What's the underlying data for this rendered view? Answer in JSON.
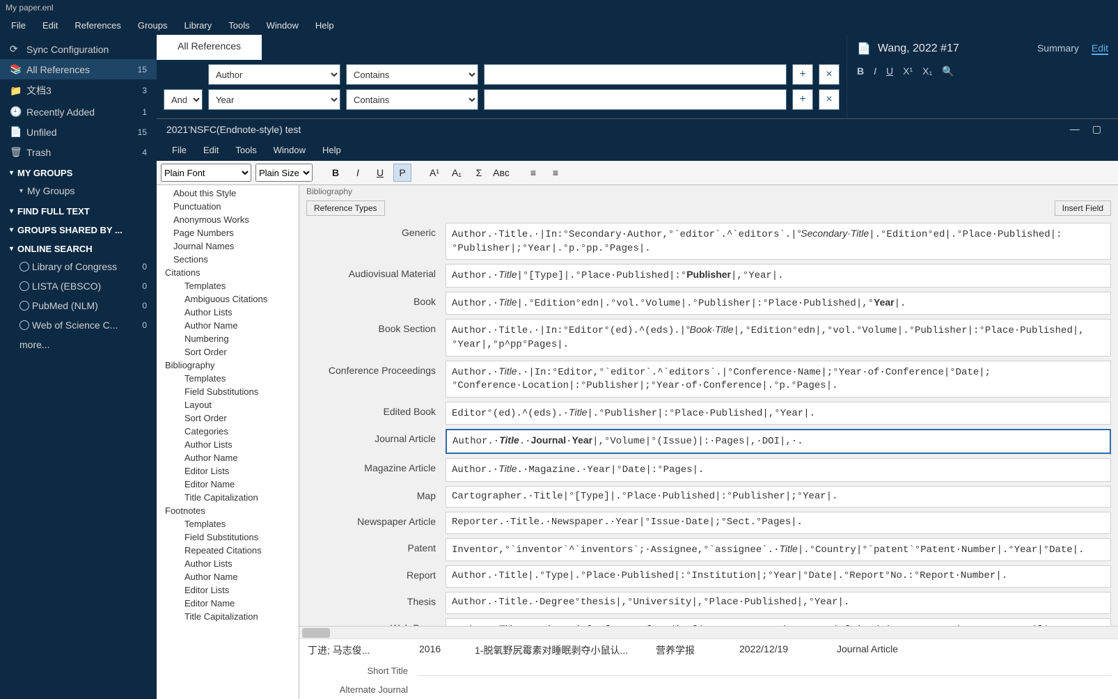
{
  "titlebar": "My paper.enl",
  "menubar": [
    "File",
    "Edit",
    "References",
    "Groups",
    "Library",
    "Tools",
    "Window",
    "Help"
  ],
  "sidebar": {
    "sync": "Sync Configuration",
    "all": {
      "label": "All References",
      "count": "15"
    },
    "docs": {
      "label": "文档3",
      "count": "3"
    },
    "recent": {
      "label": "Recently Added",
      "count": "1"
    },
    "unfiled": {
      "label": "Unfiled",
      "count": "15"
    },
    "trash": {
      "label": "Trash",
      "count": "4"
    },
    "mygroups_head": "MY GROUPS",
    "mygroups_item": "My Groups",
    "findfull": "FIND FULL TEXT",
    "shared": "GROUPS SHARED BY ...",
    "online_head": "ONLINE SEARCH",
    "online": [
      {
        "label": "Library of Congress",
        "count": "0"
      },
      {
        "label": "LISTA (EBSCO)",
        "count": "0"
      },
      {
        "label": "PubMed (NLM)",
        "count": "0"
      },
      {
        "label": "Web of Science C...",
        "count": "0"
      }
    ],
    "more": "more..."
  },
  "maintab": "All References",
  "search": {
    "rows": [
      {
        "op": "",
        "field": "Author",
        "cond": "Contains",
        "val": ""
      },
      {
        "op": "And",
        "field": "Year",
        "cond": "Contains",
        "val": ""
      }
    ],
    "plus": "+",
    "x": "×"
  },
  "right": {
    "ref_title": "Wang, 2022 #17",
    "tabs": {
      "summary": "Summary",
      "edit": "Edit"
    },
    "fmt": {
      "b": "B",
      "i": "I",
      "u": "U",
      "sup": "X¹",
      "sub": "X₁",
      "search": "🔍"
    }
  },
  "stylewin": {
    "title": "2021'NSFC(Endnote-style) test",
    "menu": [
      "File",
      "Edit",
      "Tools",
      "Window",
      "Help"
    ],
    "font": "Plain Font",
    "size": "Plain Size",
    "tb": {
      "b": "B",
      "i": "I",
      "u": "U",
      "p": "P",
      "sup": "A¹",
      "sub": "A₁",
      "sigma": "Σ",
      "abc": "Aʙᴄ",
      "al_l": "≡",
      "al_c": "≡"
    },
    "tree": [
      {
        "l": 1,
        "t": "About this Style"
      },
      {
        "l": 1,
        "t": "Punctuation"
      },
      {
        "l": 1,
        "t": "Anonymous Works"
      },
      {
        "l": 1,
        "t": "Page Numbers"
      },
      {
        "l": 1,
        "t": "Journal Names"
      },
      {
        "l": 1,
        "t": "Sections"
      },
      {
        "l": 0,
        "t": "Citations"
      },
      {
        "l": 2,
        "t": "Templates"
      },
      {
        "l": 2,
        "t": "Ambiguous Citations"
      },
      {
        "l": 2,
        "t": "Author Lists"
      },
      {
        "l": 2,
        "t": "Author Name"
      },
      {
        "l": 2,
        "t": "Numbering"
      },
      {
        "l": 2,
        "t": "Sort Order"
      },
      {
        "l": 0,
        "t": "Bibliography"
      },
      {
        "l": 2,
        "t": "Templates"
      },
      {
        "l": 2,
        "t": "Field Substitutions"
      },
      {
        "l": 2,
        "t": "Layout"
      },
      {
        "l": 2,
        "t": "Sort Order"
      },
      {
        "l": 2,
        "t": "Categories"
      },
      {
        "l": 2,
        "t": "Author Lists"
      },
      {
        "l": 2,
        "t": "Author Name"
      },
      {
        "l": 2,
        "t": "Editor Lists"
      },
      {
        "l": 2,
        "t": "Editor Name"
      },
      {
        "l": 2,
        "t": "Title Capitalization"
      },
      {
        "l": 0,
        "t": "Footnotes"
      },
      {
        "l": 2,
        "t": "Templates"
      },
      {
        "l": 2,
        "t": "Field Substitutions"
      },
      {
        "l": 2,
        "t": "Repeated Citations"
      },
      {
        "l": 2,
        "t": "Author Lists"
      },
      {
        "l": 2,
        "t": "Author Name"
      },
      {
        "l": 2,
        "t": "Editor Lists"
      },
      {
        "l": 2,
        "t": "Editor Name"
      },
      {
        "l": 2,
        "t": "Title Capitalization"
      }
    ],
    "ed_head": "Bibliography",
    "btn_reftypes": "Reference Types",
    "btn_insert": "Insert Field",
    "templates": [
      {
        "label": "Generic",
        "html": "Author.·Title.·|In:°Secondary·Author,°`editor`.^`editors`.|<i>°Secondary·Title</i>|.°Edition°ed|.°Place·Published|:°Publisher|;°Year|.°p.°pp.°Pages|."
      },
      {
        "label": "Audiovisual Material",
        "html": "Author.·<i>Title</i>|°[Type]|.°Place·Published|:°<b>Publisher</b>|,°Year|."
      },
      {
        "label": "Book",
        "html": "Author.·<i>Title</i>|.°Edition°edn|.°vol.°Volume|.°Publisher|:°Place·Published|,°<b>Year</b>|."
      },
      {
        "label": "Book Section",
        "html": "Author.·Title.·|In:°Editor°(ed).^(eds).|<i>°Book·Title</i>|,°Edition°edn|,°vol.°Volume|.°Publisher|:°Place·Published|,°Year|,°p^pp°Pages|."
      },
      {
        "label": "Conference Proceedings",
        "html": "Author.·<i>Title</i>.·|In:°Editor,°`editor`.^`editors`.|°Conference·Name|;°Year·of·Conference|°Date|;°Conference·Location|:°Publisher|;°Year·of·Conference|.°p.°Pages|."
      },
      {
        "label": "Edited Book",
        "html": "Editor°(ed).^(eds).·<i>Title</i>|.°Publisher|:°Place·Published|,°Year|."
      },
      {
        "label": "Journal Article",
        "html": "Author.·<b><i>Title</i></b>.·<b>Journal</b>·<b>Year</b>|,°Volume|°(Issue)|:·Pages|,·DOI|,·.",
        "sel": true
      },
      {
        "label": "Magazine Article",
        "html": "Author.·<i>Title</i>.·Magazine.·Year|°Date|:°Pages|."
      },
      {
        "label": "Map",
        "html": "Cartographer.·Title|°[Type]|.°Place·Published|:°Publisher|;°Year|."
      },
      {
        "label": "Newspaper Article",
        "html": "Reporter.·Title.·Newspaper.·Year|°Issue·Date|;°Sect.°Pages|."
      },
      {
        "label": "Patent",
        "html": "Inventor,°`inventor`^`inventors`;·Assignee,°`assignee`.·<i>Title</i>|.°Country|°`patent`°Patent·Number|.°Year|°Date|."
      },
      {
        "label": "Report",
        "html": "Author.·Title|.°Type|.°Place·Published|:°Institution|;°Year|°Date|.°Report°No.:°Report·Number|."
      },
      {
        "label": "Thesis",
        "html": "Author.·Title.·Degree°thesis|,°University|,°Place·Published|,°Year|."
      },
      {
        "label": "Web Page",
        "html": "Author.·<i>Title</i>.·Series·Title·[Type·of·Medium]|·Year°Last·Update·Date|·[cited°|Access·Year|·Access·Date|]|;°Edition:[Description].·`Available·from:`·URL"
      }
    ]
  },
  "reflist": {
    "author": "丁进; 马志俊...",
    "year": "2016",
    "title": "1-脱氧野尻霉素对睡眠剥夺小鼠认...",
    "journal": "营养学报",
    "date": "2022/12/19",
    "type": "Journal Article"
  },
  "detail": {
    "shorttitle": "Short Title",
    "altjournal": "Alternate Journal"
  }
}
